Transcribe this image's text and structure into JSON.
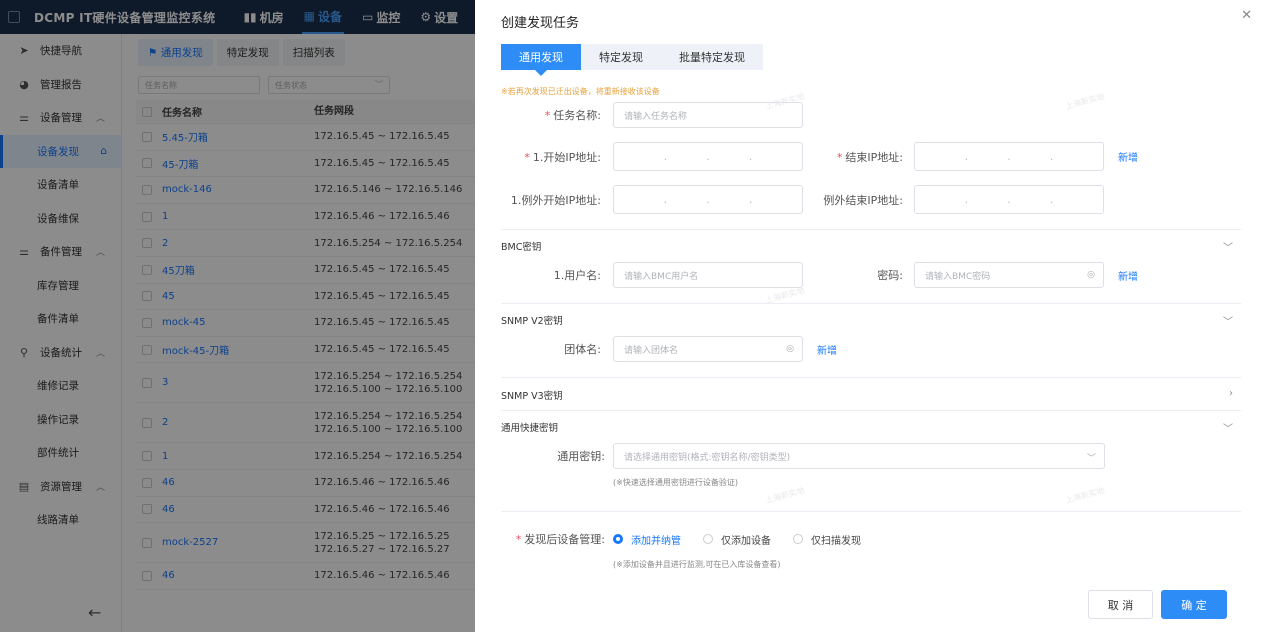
{
  "app": {
    "title": "DCMP IT硬件设备管理监控系统"
  },
  "topnav": [
    {
      "label": "机房",
      "icon": "bar-chart-icon",
      "active": false
    },
    {
      "label": "设备",
      "icon": "grid-icon",
      "active": true
    },
    {
      "label": "监控",
      "icon": "monitor-icon",
      "active": false
    },
    {
      "label": "设置",
      "icon": "gear-icon",
      "active": false
    }
  ],
  "sidebar": {
    "items": [
      {
        "label": "快捷导航",
        "icon": "send-icon",
        "type": "group"
      },
      {
        "label": "管理报告",
        "icon": "pie-icon",
        "type": "group"
      },
      {
        "label": "设备管理",
        "icon": "sliders-icon",
        "type": "group",
        "expanded": true
      },
      {
        "label": "设备发现",
        "type": "sub",
        "active": true
      },
      {
        "label": "设备清单",
        "type": "sub"
      },
      {
        "label": "设备维保",
        "type": "sub"
      },
      {
        "label": "备件管理",
        "icon": "sliders-icon",
        "type": "group",
        "expanded": true
      },
      {
        "label": "库存管理",
        "type": "sub"
      },
      {
        "label": "备件清单",
        "type": "sub"
      },
      {
        "label": "设备统计",
        "icon": "search-icon",
        "type": "group",
        "expanded": true
      },
      {
        "label": "维修记录",
        "type": "sub"
      },
      {
        "label": "操作记录",
        "type": "sub"
      },
      {
        "label": "部件统计",
        "type": "sub"
      },
      {
        "label": "资源管理",
        "icon": "table-icon",
        "type": "group",
        "expanded": true
      },
      {
        "label": "线路清单",
        "type": "sub"
      }
    ]
  },
  "main": {
    "tabs": [
      {
        "label": "通用发现",
        "active": true
      },
      {
        "label": "特定发现",
        "active": false
      },
      {
        "label": "扫描列表",
        "active": false
      }
    ],
    "filters": {
      "name_placeholder": "任务名称",
      "status_placeholder": "任务状态"
    },
    "columns": [
      "任务名称",
      "任务网段"
    ],
    "rows": [
      {
        "name": "5.45-刀箱",
        "ranges": [
          "172.16.5.45 ~ 172.16.5.45"
        ]
      },
      {
        "name": "45-刀箱",
        "ranges": [
          "172.16.5.45 ~ 172.16.5.45"
        ]
      },
      {
        "name": "mock-146",
        "ranges": [
          "172.16.5.146 ~ 172.16.5.146"
        ]
      },
      {
        "name": "1",
        "ranges": [
          "172.16.5.46 ~ 172.16.5.46"
        ]
      },
      {
        "name": "2",
        "ranges": [
          "172.16.5.254 ~ 172.16.5.254"
        ]
      },
      {
        "name": "45刀箱",
        "ranges": [
          "172.16.5.45 ~ 172.16.5.45"
        ]
      },
      {
        "name": "45",
        "ranges": [
          "172.16.5.45 ~ 172.16.5.45"
        ]
      },
      {
        "name": "mock-45",
        "ranges": [
          "172.16.5.45 ~ 172.16.5.45"
        ]
      },
      {
        "name": "mock-45-刀箱",
        "ranges": [
          "172.16.5.45 ~ 172.16.5.45"
        ]
      },
      {
        "name": "3",
        "ranges": [
          "172.16.5.254 ~ 172.16.5.254",
          "172.16.5.100 ~ 172.16.5.100"
        ]
      },
      {
        "name": "2",
        "ranges": [
          "172.16.5.254 ~ 172.16.5.254",
          "172.16.5.100 ~ 172.16.5.100"
        ]
      },
      {
        "name": "1",
        "ranges": [
          "172.16.5.254 ~ 172.16.5.254"
        ]
      },
      {
        "name": "46",
        "ranges": [
          "172.16.5.46 ~ 172.16.5.46"
        ]
      },
      {
        "name": "46",
        "ranges": [
          "172.16.5.46 ~ 172.16.5.46"
        ]
      },
      {
        "name": "mock-2527",
        "ranges": [
          "172.16.5.25 ~ 172.16.5.25",
          "172.16.5.27 ~ 172.16.5.27"
        ]
      },
      {
        "name": "46",
        "ranges": [
          "172.16.5.46 ~ 172.16.5.46"
        ]
      }
    ]
  },
  "drawer": {
    "title": "创建发现任务",
    "tabs": [
      "通用发现",
      "特定发现",
      "批量特定发现"
    ],
    "warning": "※若再次发现已迁出设备，将重新接收该设备",
    "task_name_label": "任务名称:",
    "task_name_placeholder": "请输入任务名称",
    "start_ip_label": "1.开始IP地址:",
    "end_ip_label": "结束IP地址:",
    "add_label": "新增",
    "ex_start_label": "1.例外开始IP地址:",
    "ex_end_label": "例外结束IP地址:",
    "bmc_title": "BMC密钥",
    "user_label": "1.用户名:",
    "user_placeholder": "请输入BMC用户名",
    "pwd_label": "密码:",
    "pwd_placeholder": "请输入BMC密码",
    "snmp2_title": "SNMP V2密钥",
    "community_label": "团体名:",
    "community_placeholder": "请输入团体名",
    "snmp3_title": "SNMP V3密钥",
    "quick_title": "通用快捷密钥",
    "quick_label": "通用密钥:",
    "quick_placeholder": "请选择通用密钥(格式:密钥名称/密钥类型)",
    "quick_hint": "(※快速选择通用密钥进行设备验证)",
    "after_label": "发现后设备管理:",
    "options": [
      "添加并纳管",
      "仅添加设备",
      "仅扫描发现"
    ],
    "after_hint": "(※添加设备并且进行监测,可在已入库设备查看)",
    "cancel": "取 消",
    "confirm": "确 定"
  },
  "watermark": "上海新实地"
}
